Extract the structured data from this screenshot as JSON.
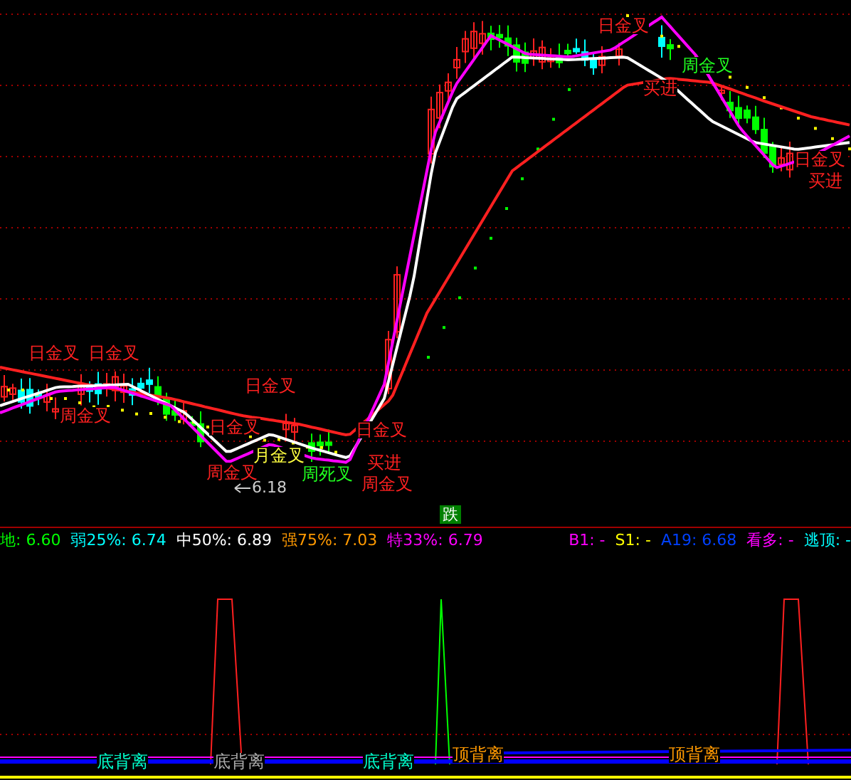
{
  "main_chart": {
    "annotations": [
      {
        "text": "日金叉",
        "color": "#ff2020"
      },
      {
        "text": "日金叉",
        "color": "#ff2020"
      },
      {
        "text": "周金叉",
        "color": "#ff2020"
      },
      {
        "text": "日金叉",
        "color": "#ff2020"
      },
      {
        "text": "日金叉",
        "color": "#ff2020"
      },
      {
        "text": "月金叉",
        "color": "#ffff40"
      },
      {
        "text": "周金叉",
        "color": "#ff2020"
      },
      {
        "text": "周死叉",
        "color": "#20ff20"
      },
      {
        "text": "日金叉",
        "color": "#ff2020"
      },
      {
        "text": "买进",
        "color": "#ff2020"
      },
      {
        "text": "周金叉",
        "color": "#ff2020"
      },
      {
        "text": "日金叉",
        "color": "#ff2020"
      },
      {
        "text": "周金叉",
        "color": "#20ff20"
      },
      {
        "text": "买进",
        "color": "#ff2020"
      },
      {
        "text": "日金叉",
        "color": "#ff2020"
      },
      {
        "text": "买进",
        "color": "#ff2020"
      }
    ],
    "low_price": "6.18",
    "signal": "跌"
  },
  "info_bar": {
    "left": [
      {
        "text": "地: 6.60",
        "color": "#00ff00"
      },
      {
        "text": "弱25%: 6.74",
        "color": "#00ffff"
      },
      {
        "text": "中50%: 6.89",
        "color": "#ffffff"
      },
      {
        "text": "强75%: 7.03",
        "color": "#ff9900"
      },
      {
        "text": "特33%: 6.79",
        "color": "#ff00ff"
      }
    ],
    "right": [
      {
        "text": "B1: -",
        "color": "#ff00ff"
      },
      {
        "text": "S1: -",
        "color": "#ffff00"
      },
      {
        "text": "A19: 6.68",
        "color": "#0040ff"
      },
      {
        "text": "看多: -",
        "color": "#ff00ff"
      },
      {
        "text": "逃顶: -",
        "color": "#00ffff"
      }
    ]
  },
  "indicator": {
    "labels": [
      {
        "text": "底背离",
        "color": "#00ffcc"
      },
      {
        "text": "底背离",
        "color": "#aaaaaa"
      },
      {
        "text": "底背离",
        "color": "#00ffcc"
      },
      {
        "text": "顶背离",
        "color": "#ff9900"
      },
      {
        "text": "顶背离",
        "color": "#ff9900"
      }
    ]
  }
}
